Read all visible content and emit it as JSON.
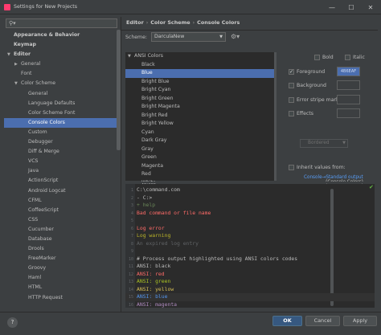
{
  "window": {
    "title": "Settings for New Projects",
    "controls": [
      "—",
      "☐",
      "✕"
    ]
  },
  "search": {
    "icon": "search-icon",
    "value": ""
  },
  "tree": [
    {
      "label": "Appearance & Behavior",
      "level": 0,
      "arrow": "",
      "bold": true
    },
    {
      "label": "Keymap",
      "level": 0,
      "arrow": "",
      "bold": true
    },
    {
      "label": "Editor",
      "level": 0,
      "arrow": "▼",
      "bold": true
    },
    {
      "label": "General",
      "level": 1,
      "arrow": "▶"
    },
    {
      "label": "Font",
      "level": 1,
      "arrow": ""
    },
    {
      "label": "Color Scheme",
      "level": 1,
      "arrow": "▼"
    },
    {
      "label": "General",
      "level": 2,
      "arrow": ""
    },
    {
      "label": "Language Defaults",
      "level": 2,
      "arrow": ""
    },
    {
      "label": "Color Scheme Font",
      "level": 2,
      "arrow": ""
    },
    {
      "label": "Console Colors",
      "level": 2,
      "arrow": "",
      "selected": true
    },
    {
      "label": "Custom",
      "level": 2,
      "arrow": ""
    },
    {
      "label": "Debugger",
      "level": 2,
      "arrow": ""
    },
    {
      "label": "Diff & Merge",
      "level": 2,
      "arrow": ""
    },
    {
      "label": "VCS",
      "level": 2,
      "arrow": ""
    },
    {
      "label": "Java",
      "level": 2,
      "arrow": ""
    },
    {
      "label": "ActionScript",
      "level": 2,
      "arrow": ""
    },
    {
      "label": "Android Logcat",
      "level": 2,
      "arrow": ""
    },
    {
      "label": "CFML",
      "level": 2,
      "arrow": ""
    },
    {
      "label": "CoffeeScript",
      "level": 2,
      "arrow": ""
    },
    {
      "label": "CSS",
      "level": 2,
      "arrow": ""
    },
    {
      "label": "Cucumber",
      "level": 2,
      "arrow": ""
    },
    {
      "label": "Database",
      "level": 2,
      "arrow": ""
    },
    {
      "label": "Drools",
      "level": 2,
      "arrow": ""
    },
    {
      "label": "FreeMarker",
      "level": 2,
      "arrow": ""
    },
    {
      "label": "Groovy",
      "level": 2,
      "arrow": ""
    },
    {
      "label": "Haml",
      "level": 2,
      "arrow": ""
    },
    {
      "label": "HTML",
      "level": 2,
      "arrow": ""
    },
    {
      "label": "HTTP Request",
      "level": 2,
      "arrow": ""
    }
  ],
  "breadcrumb": {
    "items": [
      "Editor",
      "Color Scheme",
      "Console Colors"
    ],
    "separator": "›"
  },
  "scheme": {
    "label": "Scheme:",
    "value": "DarculaNew",
    "gear_icon": "gear-icon"
  },
  "attributes": [
    {
      "label": "ANSI Colors",
      "group": true,
      "arrow": "▼"
    },
    {
      "label": "Black"
    },
    {
      "label": "Blue",
      "selected": true
    },
    {
      "label": "Bright Blue"
    },
    {
      "label": "Bright Cyan"
    },
    {
      "label": "Bright Green"
    },
    {
      "label": "Bright Magenta"
    },
    {
      "label": "Bright Red"
    },
    {
      "label": "Bright Yellow"
    },
    {
      "label": "Cyan"
    },
    {
      "label": "Dark Gray"
    },
    {
      "label": "Gray"
    },
    {
      "label": "Green"
    },
    {
      "label": "Magenta"
    },
    {
      "label": "Red"
    },
    {
      "label": "White"
    }
  ],
  "options": {
    "bold": {
      "label": "Bold",
      "checked": false
    },
    "italic": {
      "label": "Italic",
      "checked": false
    },
    "foreground": {
      "label": "Foreground",
      "checked": true,
      "value": "4B6EAF",
      "color": "#4b6eaf"
    },
    "background": {
      "label": "Background",
      "checked": false
    },
    "error_stripe": {
      "label": "Error stripe mark",
      "checked": false
    },
    "effects": {
      "label": "Effects",
      "checked": false
    },
    "effect_type": "Bordered",
    "inherit": {
      "label": "Inherit values from:",
      "checked": false
    },
    "inherit_link": "Console→Standard output",
    "inherit_sub": "(Console Colors)"
  },
  "preview": [
    {
      "n": "1",
      "text": "C:\\command.com",
      "color": "#bbbbbb"
    },
    {
      "n": "2",
      "text": "- C:>",
      "color": "#bbbbbb"
    },
    {
      "n": "3",
      "text": "+ help",
      "color": "#6a8759"
    },
    {
      "n": "4",
      "text": "Bad command or file name",
      "color": "#ff6b68"
    },
    {
      "n": "5",
      "text": "",
      "color": "#bbbbbb"
    },
    {
      "n": "6",
      "text": "Log error",
      "color": "#ff6b68"
    },
    {
      "n": "7",
      "text": "Log warning",
      "color": "#bbb529"
    },
    {
      "n": "8",
      "text": "An expired log entry",
      "color": "#606366"
    },
    {
      "n": "9",
      "text": "",
      "color": "#bbbbbb"
    },
    {
      "n": "10",
      "text": "# Process output highlighted using ANSI colors codes",
      "color": "#bbbbbb"
    },
    {
      "n": "11",
      "text": "ANSI: black",
      "color": "#bbbbbb"
    },
    {
      "n": "12",
      "text": "ANSI: red",
      "color": "#ff6b68"
    },
    {
      "n": "13",
      "text": "ANSI: green",
      "color": "#a8c023"
    },
    {
      "n": "14",
      "text": "ANSI: yellow",
      "color": "#d6bf55"
    },
    {
      "n": "15",
      "text": "ANSI: blue",
      "color": "#5394ec",
      "caret": true
    },
    {
      "n": "16",
      "text": "ANSI: magenta",
      "color": "#ae8abe"
    }
  ],
  "buttons": {
    "help": "?",
    "ok": "OK",
    "cancel": "Cancel",
    "apply": "Apply"
  }
}
